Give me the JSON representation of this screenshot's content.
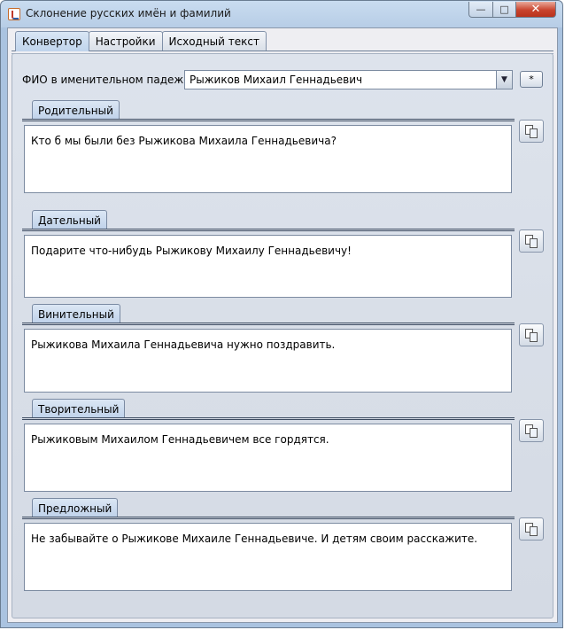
{
  "window": {
    "title": "Склонение русских имён и фамилий",
    "minimize_glyph": "—",
    "maximize_glyph": "□",
    "close_glyph": "✕"
  },
  "tabs": [
    {
      "label": "Конвертор",
      "active": true
    },
    {
      "label": "Настройки",
      "active": false
    },
    {
      "label": "Исходный текст",
      "active": false
    }
  ],
  "form": {
    "fio_label": "ФИО в именительном падеже:",
    "fio_value": "Рыжиков Михаил Геннадьевич",
    "star_button": "*"
  },
  "cases": [
    {
      "name": "Родительный",
      "text": "Кто б мы были без Рыжикова Михаила Геннадьевича?"
    },
    {
      "name": "Дательный",
      "text": "Подарите что-нибудь Рыжикову Михаилу Геннадьевичу!"
    },
    {
      "name": "Винительный",
      "text": "Рыжикова Михаила Геннадьевича нужно поздравить."
    },
    {
      "name": "Творительный",
      "text": "Рыжиковым Михаилом Геннадьевичем все гордятся."
    },
    {
      "name": "Предложный",
      "text": "Не забывайте о Рыжикове Михаиле Геннадьевиче. И детям своим расскажите."
    }
  ],
  "icons": {
    "copy": "copy-icon",
    "app": "java-cup-icon",
    "dropdown": "chevron-down-icon"
  }
}
